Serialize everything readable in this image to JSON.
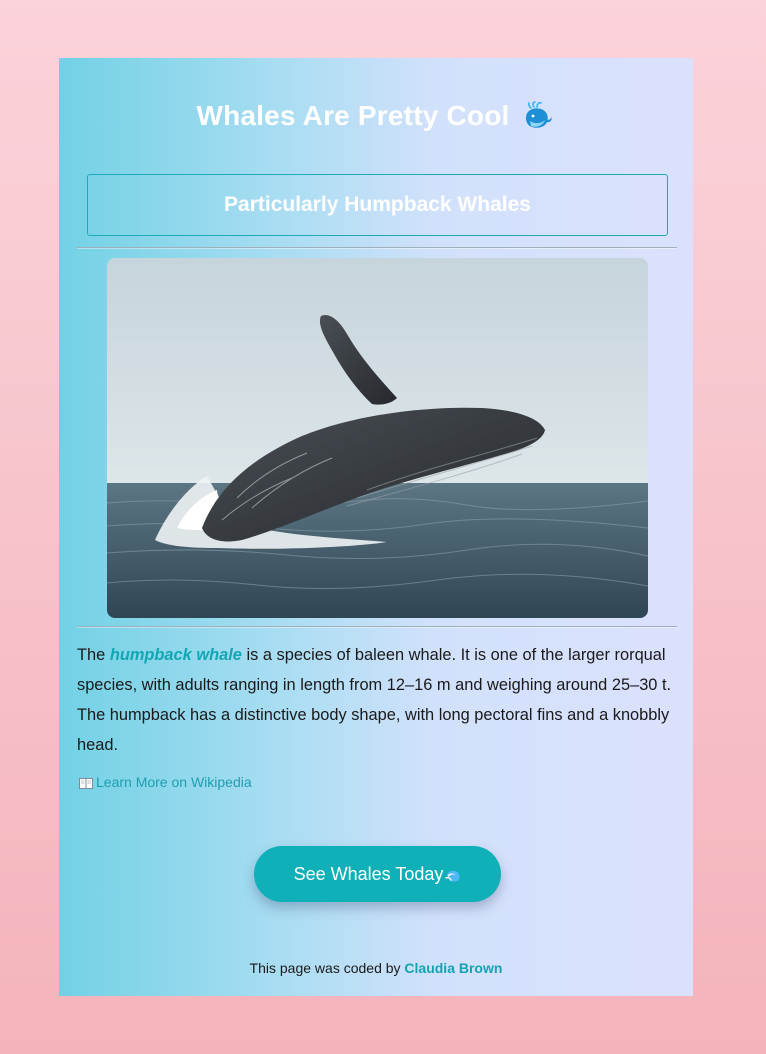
{
  "header": {
    "title": "Whales Are Pretty Cool",
    "title_icon": "spouting-whale-icon",
    "subtitle": "Particularly Humpback Whales"
  },
  "image": {
    "alt": "Humpback whale breaching"
  },
  "description": {
    "prefix": "The ",
    "highlight": "humpback whale",
    "body": " is a species of baleen whale. It is one of the larger rorqual species, with adults ranging in length from 12–16 m and weighing around 25–30 t. The humpback has a distinctive body shape, with long pectoral fins and a knobbly head."
  },
  "link": {
    "icon": "open-book-icon",
    "label": "Learn More on Wikipedia"
  },
  "cta": {
    "label": "See Whales Today",
    "icon": "water-wave-icon"
  },
  "footer": {
    "text": "This page was coded by ",
    "author": "Claudia Brown"
  },
  "colors": {
    "accent": "#0fb0b7",
    "background_pink": "#f4b3bb",
    "card_left": "#72d1e5",
    "card_right": "#dbe1fd"
  }
}
